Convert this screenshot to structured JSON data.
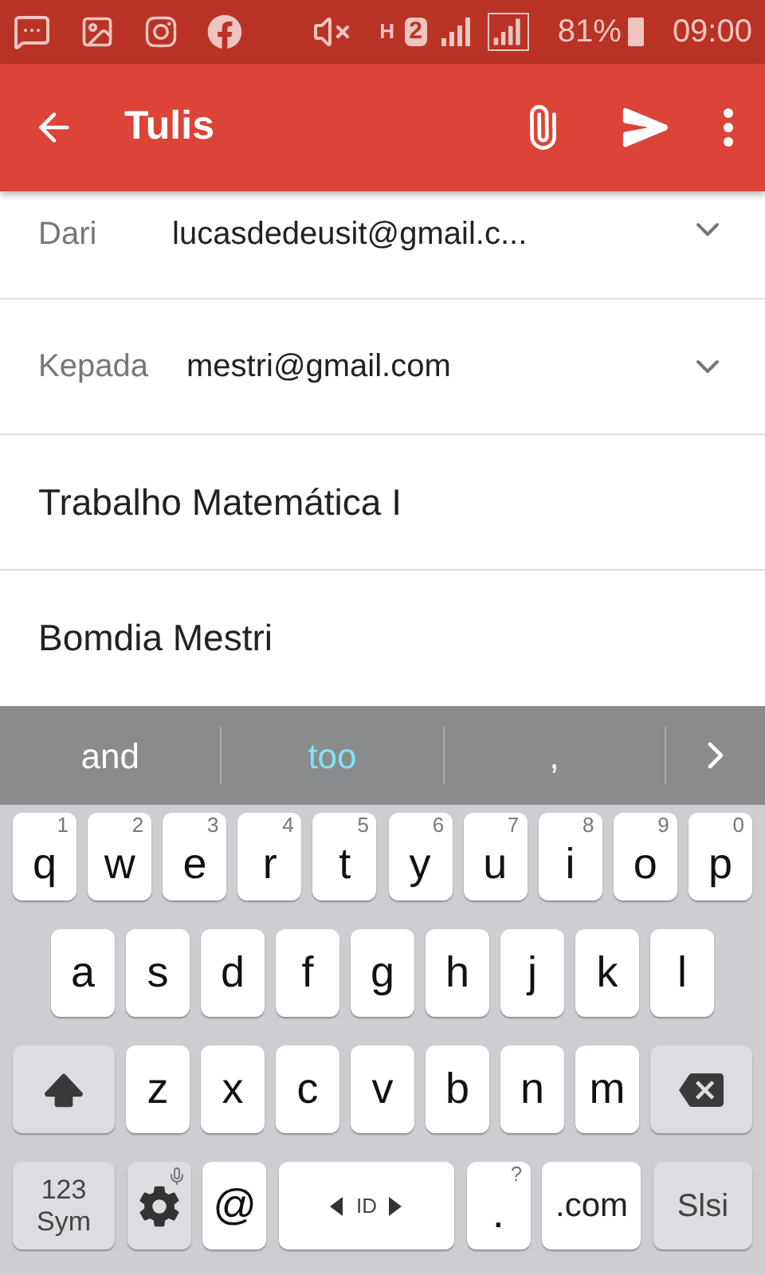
{
  "status_bar": {
    "network_type": "H",
    "sim": "2",
    "battery": "81%",
    "time": "09:00"
  },
  "toolbar": {
    "title": "Tulis"
  },
  "compose": {
    "from": {
      "label": "Dari",
      "value": "lucasdedeusit@gmail.c..."
    },
    "to": {
      "label": "Kepada",
      "value": "mestri@gmail.com"
    },
    "subject": "Trabalho Matemática I",
    "body": "Bomdia Mestri"
  },
  "suggestions": [
    {
      "text": "and",
      "selected": false
    },
    {
      "text": "too",
      "selected": true
    },
    {
      "text": ",",
      "selected": false
    }
  ],
  "keyboard": {
    "rows": [
      {
        "keys": [
          {
            "label": "q",
            "hint": "1"
          },
          {
            "label": "w",
            "hint": "2"
          },
          {
            "label": "e",
            "hint": "3"
          },
          {
            "label": "r",
            "hint": "4"
          },
          {
            "label": "t",
            "hint": "5"
          },
          {
            "label": "y",
            "hint": "6"
          },
          {
            "label": "u",
            "hint": "7"
          },
          {
            "label": "i",
            "hint": "8"
          },
          {
            "label": "o",
            "hint": "9"
          },
          {
            "label": "p",
            "hint": "0"
          }
        ]
      },
      {
        "keys": [
          {
            "label": "a"
          },
          {
            "label": "s"
          },
          {
            "label": "d"
          },
          {
            "label": "f"
          },
          {
            "label": "g"
          },
          {
            "label": "h"
          },
          {
            "label": "j"
          },
          {
            "label": "k"
          },
          {
            "label": "l"
          }
        ]
      },
      {
        "keys": [
          {
            "kind": "shift"
          },
          {
            "label": "z"
          },
          {
            "label": "x"
          },
          {
            "label": "c"
          },
          {
            "label": "v"
          },
          {
            "label": "b"
          },
          {
            "label": "n"
          },
          {
            "label": "m"
          },
          {
            "kind": "backspace"
          }
        ]
      },
      {
        "keys": [
          {
            "kind": "mode",
            "label": "123",
            "sublabel": "Sym"
          },
          {
            "kind": "settings"
          },
          {
            "label": "@"
          },
          {
            "kind": "space",
            "label": "ID"
          },
          {
            "label": ".",
            "hint": "?"
          },
          {
            "label": ".com",
            "kind": "wide"
          },
          {
            "kind": "action",
            "label": "Slsi"
          }
        ]
      }
    ]
  }
}
